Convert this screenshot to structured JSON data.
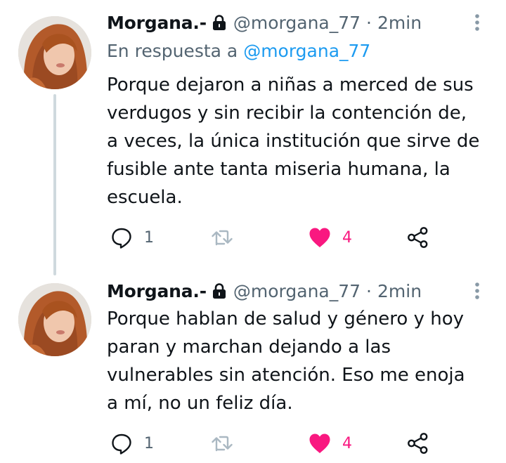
{
  "tweets": [
    {
      "name": "Morgana.-",
      "handle": "@morgana_77",
      "separator": "·",
      "time": "2min",
      "reply_prefix": "En respuesta a",
      "reply_handle": "@morgana_77",
      "lines": [
        "Porque dejaron a niñas a merced de sus",
        "verdugos y sin recibir la contención de,",
        "a veces, la única institución que sirve de",
        "fusible ante tanta miseria humana, la",
        "escuela."
      ],
      "replies": "1",
      "likes": "4"
    },
    {
      "name": "Morgana.-",
      "handle": "@morgana_77",
      "separator": "·",
      "time": "2min",
      "lines": [
        "Porque hablan de salud y género y hoy",
        "paran y marchan dejando a las",
        "vulnerables sin atención. Eso me enoja",
        "a mí, no un feliz día."
      ],
      "replies": "1",
      "likes": "4"
    }
  ],
  "colors": {
    "text": "#0f1419",
    "muted": "#536471",
    "link": "#1d9bf0",
    "like": "#f91880",
    "thread_line": "#cfd9de"
  },
  "icons": [
    "lock-icon",
    "more-options-icon",
    "reply-icon",
    "retweet-icon",
    "heart-icon",
    "share-icon"
  ]
}
